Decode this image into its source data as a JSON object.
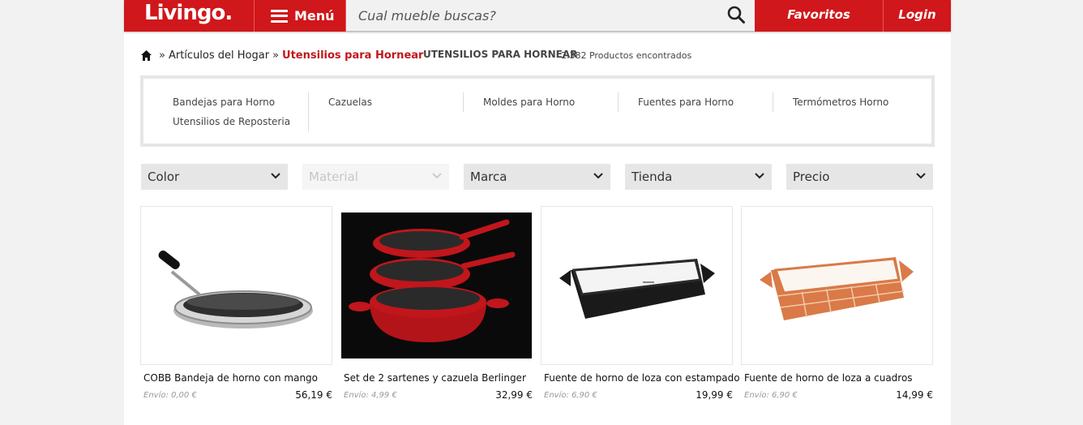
{
  "header": {
    "logo": "Livingo.",
    "menu_label": "Menú",
    "search_placeholder": "Cual mueble buscas?",
    "favorites_label": "Favoritos",
    "login_label": "Login"
  },
  "breadcrumb": {
    "parent": "Artículos del Hogar",
    "current": "Utensilios para Hornear",
    "separator": "»",
    "heading": "UTENSILIOS PARA HORNEAR",
    "results": "2.382 Productos encontrados"
  },
  "subcategories": [
    [
      "Bandejas para Horno",
      "Utensilios de Reposteria"
    ],
    [
      "Cazuelas"
    ],
    [
      "Moldes para Horno"
    ],
    [
      "Fuentes para Horno"
    ],
    [
      "Termómetros Horno"
    ]
  ],
  "filters": [
    {
      "label": "Color",
      "enabled": true
    },
    {
      "label": "Material",
      "enabled": false
    },
    {
      "label": "Marca",
      "enabled": true
    },
    {
      "label": "Tienda",
      "enabled": true
    },
    {
      "label": "Precio",
      "enabled": true
    }
  ],
  "products": [
    {
      "name": "COBB Bandeja de horno con mango",
      "shipping": "Envío: 0,00 €",
      "price": "56,19 €"
    },
    {
      "name": "Set de 2 sartenes y cazuela Berlinger",
      "shipping": "Envío: 4,99 €",
      "price": "32,99 €"
    },
    {
      "name": "Fuente de horno de loza con estampado",
      "shipping": "Envío: 6,90 €",
      "price": "19,99 €"
    },
    {
      "name": "Fuente de horno de loza a cuadros",
      "shipping": "Envío: 6,90 €",
      "price": "14,99 €"
    }
  ],
  "colors": {
    "brand_red": "#d0171b",
    "current_crumb": "#c0181c"
  },
  "icons": [
    "home-icon",
    "hamburger-icon",
    "search-icon",
    "chevron-down-icon"
  ]
}
